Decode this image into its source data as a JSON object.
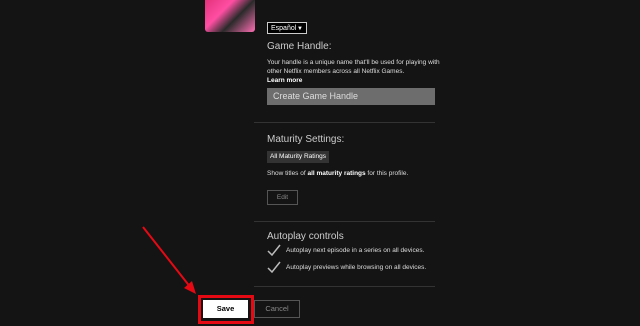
{
  "language": {
    "selected": "Español"
  },
  "game_handle": {
    "title": "Game Handle:",
    "description": "Your handle is a unique name that'll be used for playing with other Netflix members across all Netflix Games.",
    "learn_more": "Learn more",
    "placeholder": "Create Game Handle"
  },
  "maturity": {
    "title": "Maturity Settings:",
    "rating_pill": "All Maturity Ratings",
    "desc_prefix": "Show titles of ",
    "desc_bold": "all maturity ratings",
    "desc_suffix": " for this profile.",
    "edit_label": "Edit"
  },
  "autoplay": {
    "title": "Autoplay controls",
    "items": [
      {
        "label": "Autoplay next episode in a series on all devices.",
        "checked": true
      },
      {
        "label": "Autoplay previews while browsing on all devices.",
        "checked": true
      }
    ]
  },
  "actions": {
    "save_label": "Save",
    "cancel_label": "Cancel"
  },
  "colors": {
    "highlight": "#e50914",
    "background": "#141414"
  }
}
